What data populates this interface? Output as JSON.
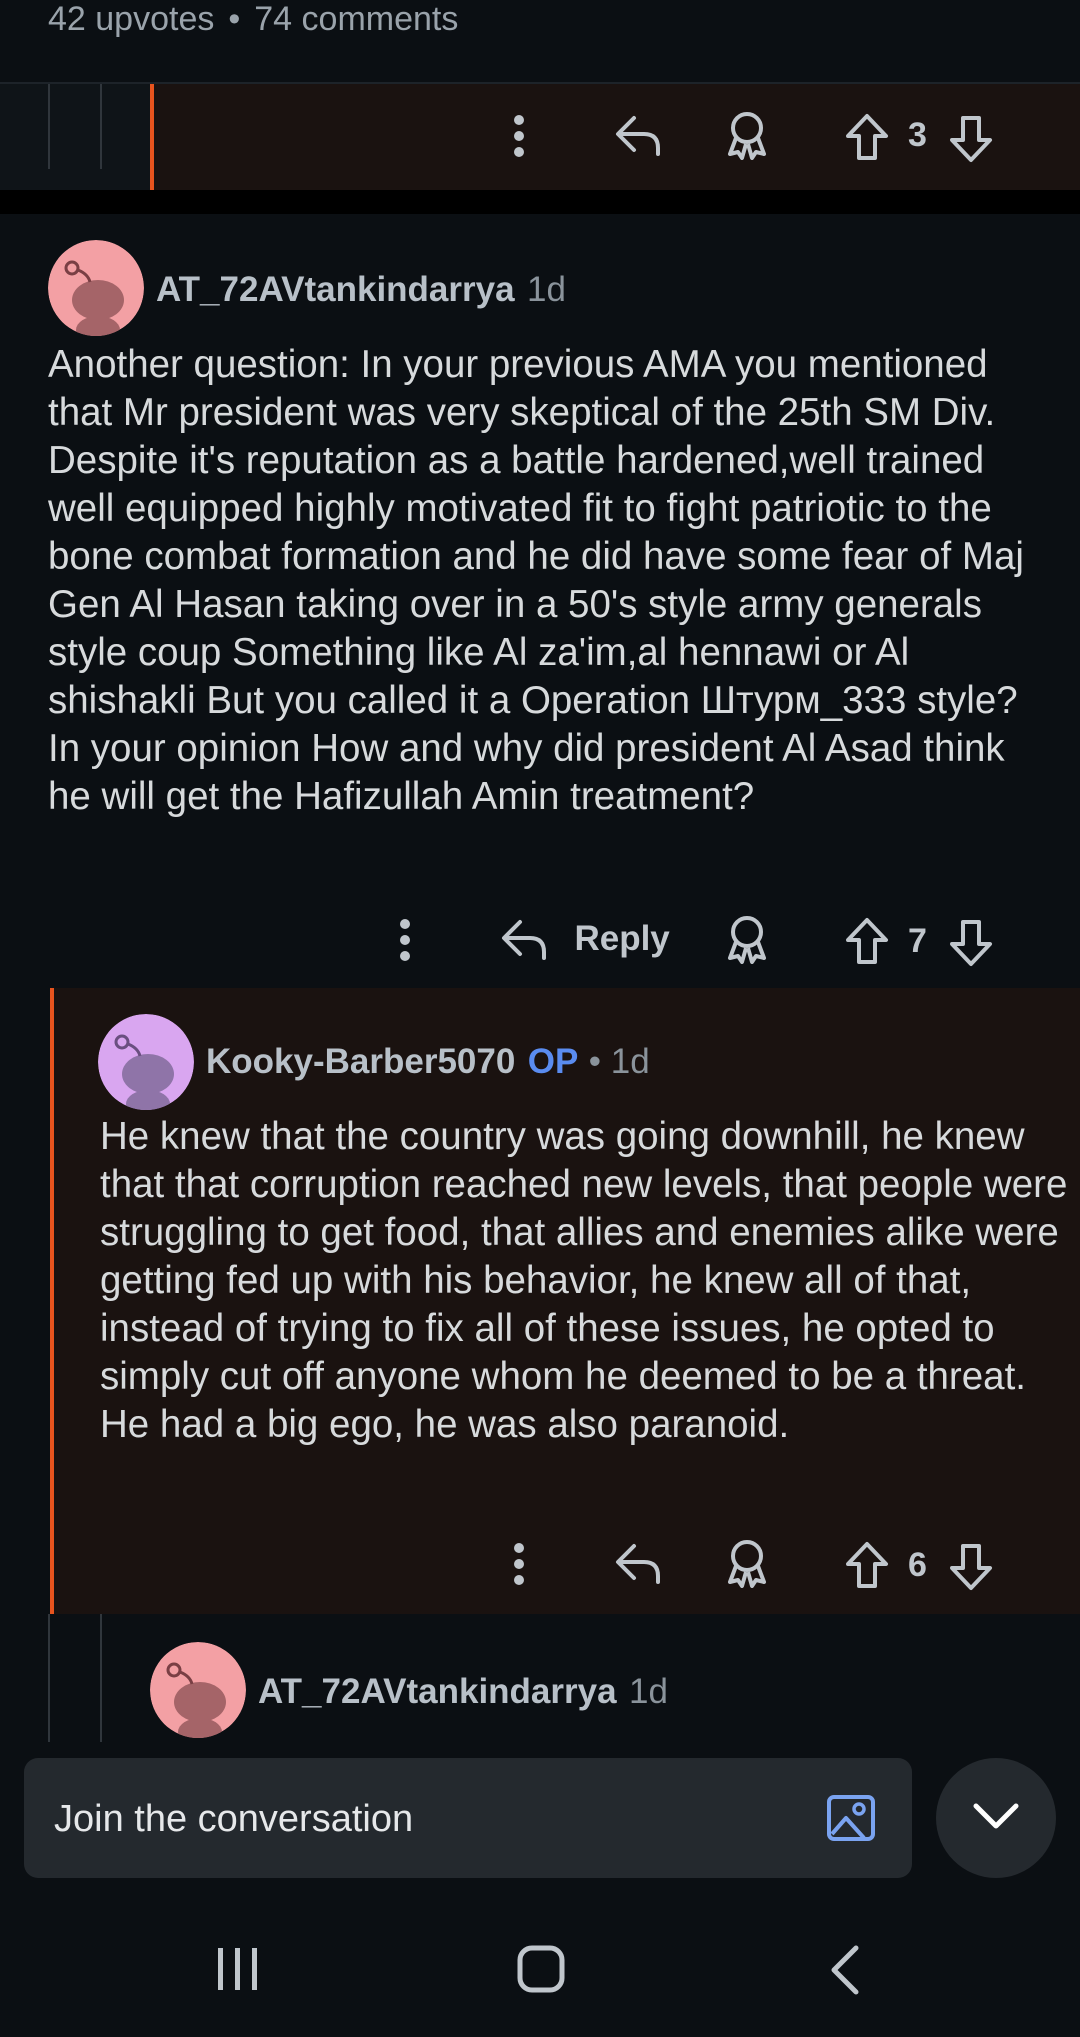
{
  "post": {
    "upvotes": "42 upvotes",
    "separator": "•",
    "comments": "74 comments"
  },
  "top_bar": {
    "vote_count": "3"
  },
  "comment1": {
    "username": "AT_72AVtankindarrya",
    "age": "1d",
    "body": "Another question: In your previous AMA you mentioned that Mr president was very skeptical of the 25th SM Div. Despite it's reputation as a battle hardened,well trained well equipped highly motivated fit to fight patriotic to the bone combat formation and he did have some fear of Maj Gen Al Hasan taking over in a 50's style army generals style coup Something like Al za'im,al hennawi or Al shishakli But you called it a Operation Штурм_333 style? In your opinion How and why did president Al Asad think he will get the Hafizullah Amin treatment?",
    "reply_label": "Reply",
    "vote_count": "7",
    "avatar_color": "#f3a0a4"
  },
  "comment2": {
    "username": "Kooky-Barber5070",
    "op_badge": "OP",
    "age": "• 1d",
    "body": "He knew that the country was going downhill, he knew that that corruption reached new levels, that people were struggling to get food, that allies and enemies alike were getting fed up with his behavior, he knew all of that, instead of trying to fix all of these issues, he opted to simply cut off anyone whom he deemed to be a threat. He had a big ego, he was also paranoid.",
    "vote_count": "6",
    "avatar_color": "#d9a6f0"
  },
  "comment3": {
    "username": "AT_72AVtankindarrya",
    "age": "1d",
    "avatar_color": "#f3a0a4"
  },
  "composer": {
    "placeholder": "Join the conversation"
  },
  "colors": {
    "accent_orange": "#e8541e",
    "op_blue": "#5a8cf0",
    "icon_blue": "#7aa3f0"
  },
  "icons": {
    "more": "more-vertical-icon",
    "reply": "reply-arrow-icon",
    "award": "award-icon",
    "upvote": "upvote-icon",
    "downvote": "downvote-icon",
    "image": "image-icon",
    "collapse": "chevron-down-icon"
  }
}
